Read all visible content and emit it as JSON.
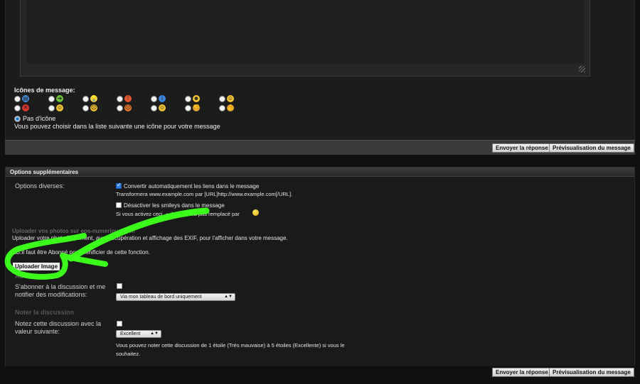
{
  "message_icons": {
    "title": "Icônes de message:",
    "no_icon_label": "Pas d'icône",
    "hint": "Vous pouvez choisir dans la liste suivante une icône pour votre message",
    "icons": [
      {
        "name": "document-icon",
        "color": "#4a90e2",
        "glyph": "▤"
      },
      {
        "name": "arrow-icon",
        "color": "#6abf3a",
        "glyph": "➜"
      },
      {
        "name": "lightbulb-icon",
        "color": "#f3d24a",
        "glyph": "💡"
      },
      {
        "name": "exclamation-icon",
        "color": "#e4572e",
        "glyph": "!"
      },
      {
        "name": "info-icon",
        "color": "#3d85d8",
        "glyph": "i"
      },
      {
        "name": "cool-smiley-icon",
        "color": "#f4c430",
        "glyph": "☻"
      },
      {
        "name": "smile-icon",
        "color": "#f4c430",
        "glyph": "☺"
      },
      {
        "name": "stop-icon",
        "color": "#d9342b",
        "glyph": "✕"
      },
      {
        "name": "laugh-icon",
        "color": "#f4c430",
        "glyph": "☺"
      },
      {
        "name": "sad-icon",
        "color": "#f4c430",
        "glyph": "☹"
      },
      {
        "name": "angry-icon",
        "color": "#f07a2a",
        "glyph": "☹"
      },
      {
        "name": "neutral-icon",
        "color": "#f4c430",
        "glyph": "☺"
      },
      {
        "name": "thumbs-down-icon",
        "color": "#e0a03a",
        "glyph": "👎"
      },
      {
        "name": "thumbs-up-icon",
        "color": "#e0a03a",
        "glyph": "👍"
      }
    ]
  },
  "buttons": {
    "submit": "Envoyer la réponse",
    "preview": "Prévisualisation du message"
  },
  "options": {
    "header": "Options supplémentaires",
    "misc_label": "Options diverses:",
    "convert_links": "Convertir automatiquement les liens dans le message",
    "convert_links_desc": "Transformera www.example.com par [URL]http://www.example.com[/URL].",
    "disable_smileys": "Désactiver les smileys dans le message",
    "disable_smileys_desc": "Si vous activez ceci, « :) » ne sera pas remplacé par",
    "upload_title": "Uploader vos photos sur eos-numerique.com",
    "upload_desc": "Uploader votre photo facilement, avec récupération et affichage des EXIF, pour l'afficher dans votre message.",
    "upload_note": "NB:Il faut être Abonné pour bénificier de cette fonction.",
    "upload_button": "Uploader Image",
    "subscription_title": "Abonnement",
    "subscription_label": "S'abonner à la discussion et me notifier des modifications:",
    "subscription_select": "Via mon tableau de bord uniquement",
    "rate_title": "Noter la discussion",
    "rate_label": "Notez cette discussion avec la valeur suivante:",
    "rate_select": "Excellent",
    "rate_desc": "Vous pouvez noter cette discussion de 1 étoile (Très mauvaise) à 5 étoiles (Excellente) si vous le souhaitez."
  },
  "annotation_color": "#3bff1a"
}
